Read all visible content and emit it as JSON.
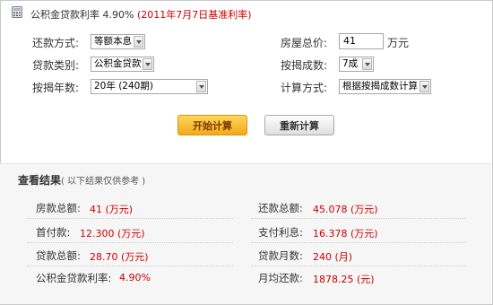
{
  "header": {
    "rate_label": "公积金贷款利率 4.90%",
    "rate_note": "(2011年7月7日基准利率)"
  },
  "form": {
    "repay_method": {
      "label": "还款方式:",
      "value": "等额本息"
    },
    "loan_type": {
      "label": "贷款类别:",
      "value": "公积金贷款"
    },
    "mortgage_years": {
      "label": "按揭年数:",
      "value": "20年 (240期)"
    },
    "house_price": {
      "label": "房屋总价:",
      "value": "41",
      "unit": "万元"
    },
    "mortgage_ratio": {
      "label": "按揭成数:",
      "value": "7成"
    },
    "calc_method": {
      "label": "计算方式:",
      "value": "根据按揭成数计算"
    }
  },
  "buttons": {
    "start": "开始计算",
    "reset": "重新计算"
  },
  "results": {
    "title": "查看结果",
    "subtitle": "( 以下结果仅供参考 )",
    "left": [
      {
        "label": "房款总额:",
        "value": "41 (万元)"
      },
      {
        "label": "首付款:",
        "value": "12.300 (万元)"
      },
      {
        "label": "贷款总额:",
        "value": "28.70 (万元)"
      },
      {
        "label": "公积金贷款利率:",
        "value": "4.90%"
      }
    ],
    "right": [
      {
        "label": "还款总额:",
        "value": "45.078 (万元)"
      },
      {
        "label": "支付利息:",
        "value": "16.378 (万元)"
      },
      {
        "label": "贷款月数:",
        "value": "240 (月)"
      },
      {
        "label": "月均还款:",
        "value": "1878.25 (元)"
      }
    ]
  },
  "colors": {
    "accent_red": "#cc0000",
    "start_button": "#f3a81c",
    "results_background": "#f6f6f6"
  }
}
